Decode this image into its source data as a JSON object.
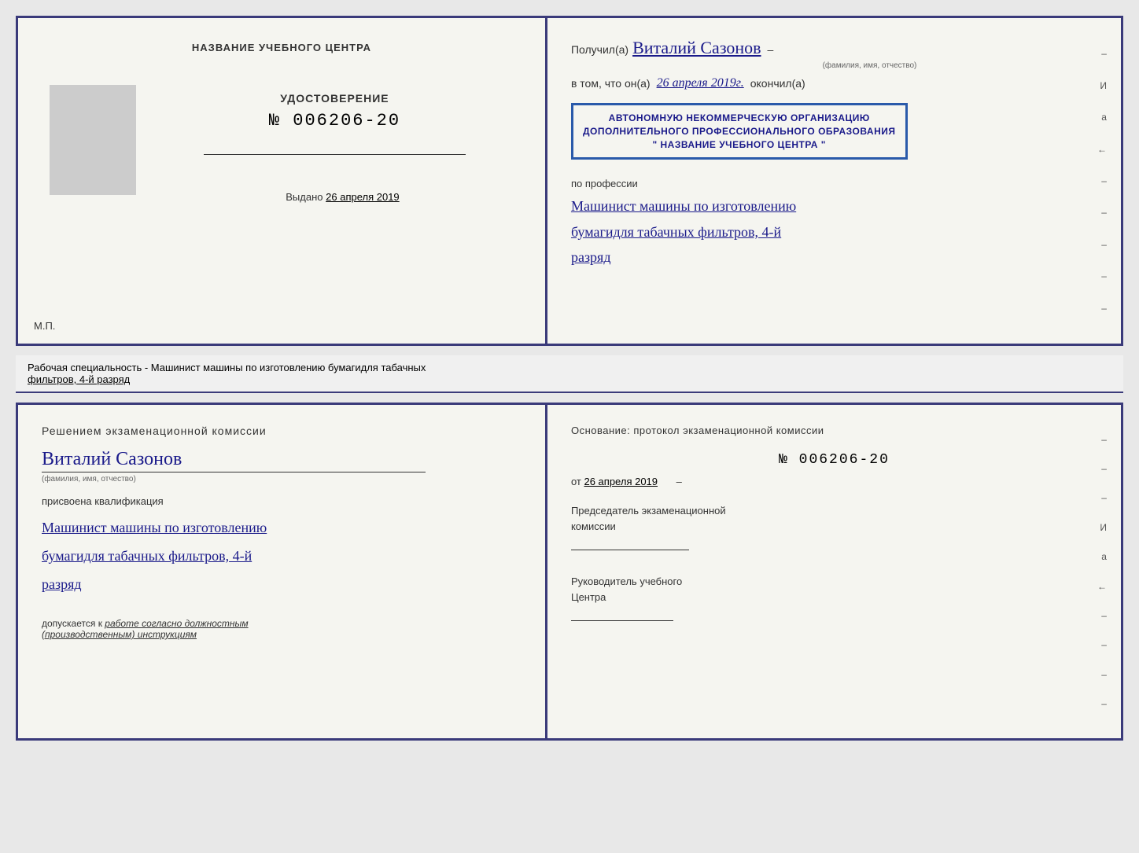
{
  "top_cert": {
    "left": {
      "header": "НАЗВАНИЕ УЧЕБНОГО ЦЕНТРА",
      "udostoverenie_label": "УДОСТОВЕРЕНИЕ",
      "number": "№ 006206-20",
      "vydano_prefix": "Выдано",
      "vydano_date": "26 апреля 2019",
      "mp_label": "М.П."
    },
    "right": {
      "poluchil_prefix": "Получил(а)",
      "name_handwritten": "Виталий Сазонов",
      "fio_caption": "(фамилия, имя, отчество)",
      "dash": "–",
      "vtom_prefix": "в том, что он(а)",
      "date_handwritten": "26 апреля 2019г.",
      "okonchil_prefix": "окончил(а)",
      "stamp_line1": "АВТОНОМНУЮ НЕКОММЕРЧЕСКУЮ ОРГАНИЗАЦИЮ",
      "stamp_line2": "ДОПОЛНИТЕЛЬНОГО ПРОФЕССИОНАЛЬНОГО ОБРАЗОВАНИЯ",
      "stamp_line3": "\" НАЗВАНИЕ УЧЕБНОГО ЦЕНТРА \"",
      "po_professii": "по профессии",
      "profession_line1": "Машинист машины по изготовлению",
      "profession_line2": "бумагидля табачных фильтров, 4-й",
      "profession_line3": "разряд",
      "side_chars": [
        "–",
        "И",
        "а",
        "←",
        "–",
        "–",
        "–",
        "–",
        "–"
      ]
    }
  },
  "annotation": {
    "text_normal": "Рабочая специальность - Машинист машины по изготовлению бумагидля табачных",
    "text_underline": "фильтров, 4-й разряд"
  },
  "bottom_cert": {
    "left": {
      "heading": "Решением  экзаменационной  комиссии",
      "name_handwritten": "Виталий Сазонов",
      "fio_caption": "(фамилия, имя, отчество)",
      "prisvoena": "присвоена квалификация",
      "prof_line1": "Машинист машины по изготовлению",
      "prof_line2": "бумагидля табачных фильтров, 4-й",
      "prof_line3": "разряд",
      "dopusk_prefix": "допускается к",
      "dopusk_italic": "работе согласно должностным",
      "dopusk_italic2": "(производственным) инструкциям"
    },
    "right": {
      "osnov": "Основание: протокол экзаменационной  комиссии",
      "number": "№ 006206-20",
      "ot_prefix": "от",
      "ot_date": "26 апреля 2019",
      "chairman_label": "Председатель экзаменационной",
      "chairman_label2": "комиссии",
      "rukov_label": "Руководитель учебного",
      "rukov_label2": "Центра",
      "side_chars": [
        "–",
        "–",
        "–",
        "И",
        "а",
        "←",
        "–",
        "–",
        "–",
        "–"
      ]
    }
  }
}
